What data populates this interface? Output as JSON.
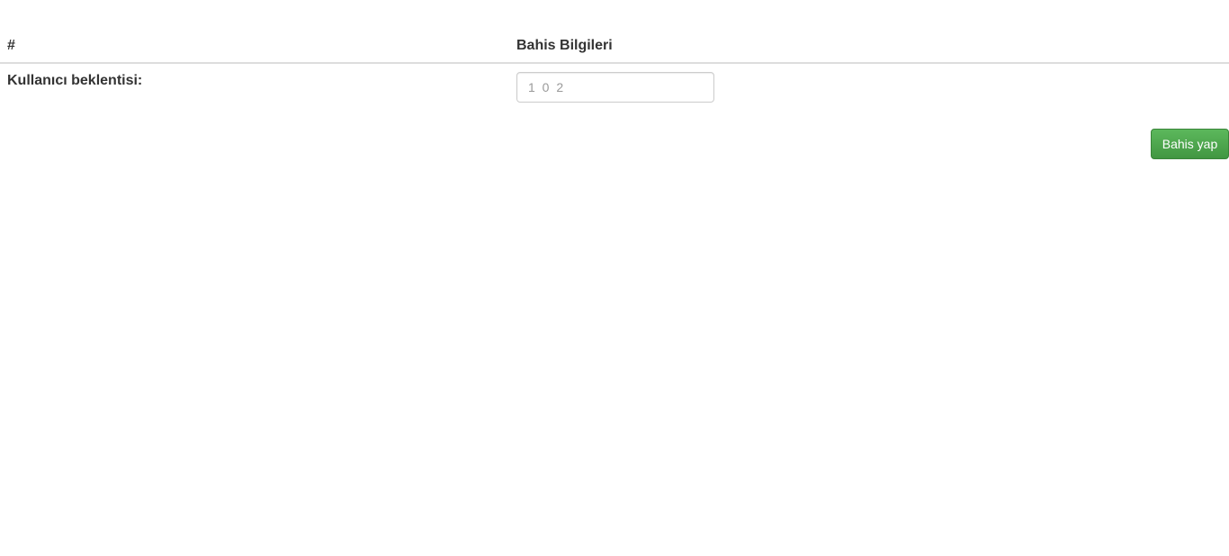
{
  "table": {
    "header": {
      "col1": "#",
      "col2": "Bahis Bilgileri"
    },
    "row": {
      "label": "Kullanıcı beklentisi:",
      "input_value": "",
      "input_placeholder": "1 0 2"
    }
  },
  "actions": {
    "submit_label": "Bahis yap",
    "submit_color": "#4cae4c"
  }
}
